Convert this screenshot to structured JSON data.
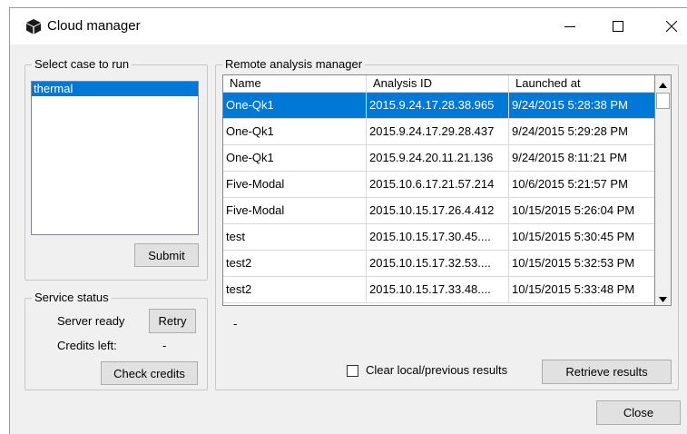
{
  "window": {
    "title": "Cloud manager",
    "icon": "cube-icon",
    "controls": [
      "minimize-icon",
      "maximize-icon",
      "close-icon"
    ]
  },
  "case_group": {
    "label": "Select case to run",
    "items": [
      {
        "label": "thermal",
        "selected": true
      }
    ],
    "submit_label": "Submit"
  },
  "service_group": {
    "label": "Service status",
    "status_text": "Server ready",
    "retry_label": "Retry",
    "credits_label": "Credits left:",
    "credits_value": "-",
    "check_credits_label": "Check credits"
  },
  "remote_group": {
    "label": "Remote analysis manager",
    "columns": [
      "Name",
      "Analysis ID",
      "Launched at"
    ],
    "rows": [
      {
        "name": "One-Qk1",
        "id": "2015.9.24.17.28.38.965",
        "launched": "9/24/2015 5:28:38 PM",
        "selected": true
      },
      {
        "name": "One-Qk1",
        "id": "2015.9.24.17.29.28.437",
        "launched": "9/24/2015 5:29:28 PM",
        "selected": false
      },
      {
        "name": "One-Qk1",
        "id": "2015.9.24.20.11.21.136",
        "launched": "9/24/2015 8:11:21 PM",
        "selected": false
      },
      {
        "name": "Five-Modal",
        "id": "2015.10.6.17.21.57.214",
        "launched": "10/6/2015 5:21:57 PM",
        "selected": false
      },
      {
        "name": "Five-Modal",
        "id": "2015.10.15.17.26.4.412",
        "launched": "10/15/2015 5:26:04 PM",
        "selected": false
      },
      {
        "name": "test",
        "id": "2015.10.15.17.30.45....",
        "launched": "10/15/2015 5:30:45 PM",
        "selected": false
      },
      {
        "name": "test2",
        "id": "2015.10.15.17.32.53....",
        "launched": "10/15/2015 5:32:53 PM",
        "selected": false
      },
      {
        "name": "test2",
        "id": "2015.10.15.17.33.48....",
        "launched": "10/15/2015 5:33:48 PM",
        "selected": false
      }
    ],
    "status_text": "-",
    "clear_checkbox_label": "Clear local/previous results",
    "clear_checkbox_checked": false,
    "retrieve_label": "Retrieve results"
  },
  "footer": {
    "close_label": "Close"
  },
  "colors": {
    "selection": "#0078d7",
    "dialog_bg": "#f0f0f0",
    "button_bg": "#e1e1e1"
  }
}
